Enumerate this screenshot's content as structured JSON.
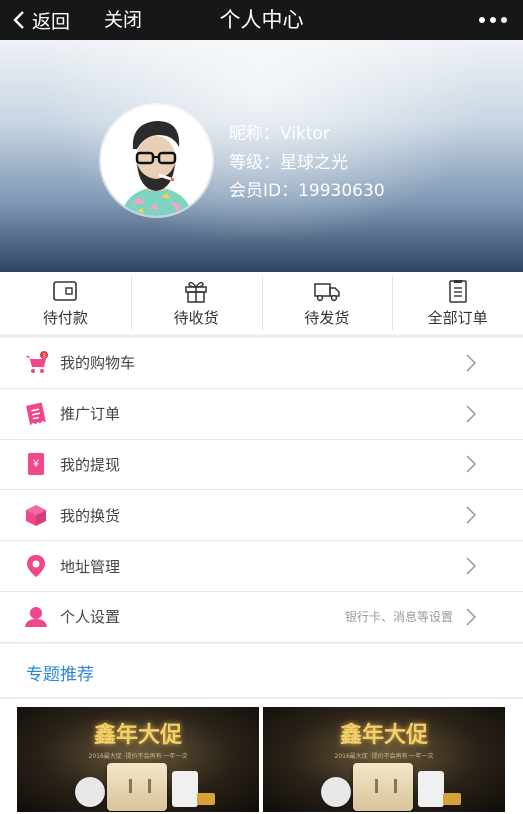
{
  "nav": {
    "back_label": "返回",
    "close_label": "关闭",
    "title": "个人中心"
  },
  "profile": {
    "nickname": "昵称：Viktor",
    "level": "等级：星球之光",
    "member_id": "会员ID：19930630"
  },
  "orders": [
    {
      "label": "待付款",
      "icon": "wallet-icon"
    },
    {
      "label": "待收货",
      "icon": "gift-icon"
    },
    {
      "label": "待发货",
      "icon": "truck-icon"
    },
    {
      "label": "全部订单",
      "icon": "clipboard-icon"
    }
  ],
  "menu": [
    {
      "label": "我的购物车",
      "icon": "cart-icon",
      "badge": "3",
      "hint": ""
    },
    {
      "label": "推广订单",
      "icon": "receipt-icon",
      "hint": ""
    },
    {
      "label": "我的提现",
      "icon": "withdraw-icon",
      "hint": ""
    },
    {
      "label": "我的换货",
      "icon": "box-icon",
      "hint": ""
    },
    {
      "label": "地址管理",
      "icon": "location-pin-icon",
      "hint": ""
    },
    {
      "label": "个人设置",
      "icon": "user-icon",
      "hint": "银行卡、消息等设置"
    }
  ],
  "recommend": {
    "title": "专题推荐"
  },
  "banners": [
    {
      "title": "鑫年大促",
      "subtitle": "2016最大促 ·提价不会再有·一年一次"
    },
    {
      "title": "鑫年大促",
      "subtitle": "2016最大促 ·提价不会再有·一年一次"
    }
  ],
  "colors": {
    "accent_pink": "#f0468c",
    "title_blue": "#2a87d4",
    "nav_bg": "#171717"
  }
}
